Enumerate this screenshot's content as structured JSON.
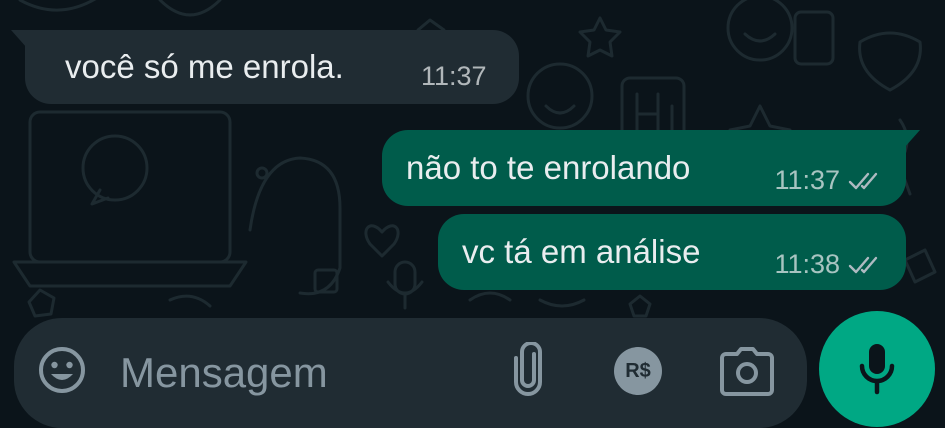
{
  "messages": [
    {
      "direction": "incoming",
      "text": "você só me enrola.",
      "time": "11:37"
    },
    {
      "direction": "outgoing",
      "text": "não to te enrolando",
      "time": "11:37",
      "status": "read"
    },
    {
      "direction": "outgoing",
      "text": "vc tá em análise",
      "time": "11:38",
      "status": "read"
    }
  ],
  "composer": {
    "placeholder": "Mensagem",
    "icons": [
      "emoji-icon",
      "attach-paperclip-icon",
      "payment-rs-icon",
      "camera-icon"
    ],
    "payment_label": "R$",
    "mic_icon": "microphone-icon"
  },
  "colors": {
    "background": "#0b141a",
    "incoming_bubble": "#202c33",
    "outgoing_bubble": "#005c4b",
    "accent": "#00a884",
    "icon_gray": "#8696a0"
  }
}
